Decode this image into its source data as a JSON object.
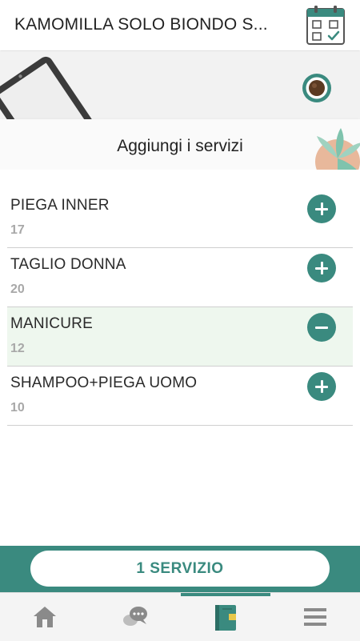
{
  "header": {
    "title": "KAMOMILLA SOLO BIONDO S...",
    "calendar_icon": "calendar-check-icon"
  },
  "hero": {
    "title": "Aggiungi i servizi",
    "illustrations": [
      "tablet-icon",
      "coffee-cup-icon",
      "plant-icon"
    ]
  },
  "services": [
    {
      "name": "PIEGA INNER",
      "duration": "17",
      "selected": false
    },
    {
      "name": "TAGLIO DONNA",
      "duration": "20",
      "selected": false
    },
    {
      "name": "MANICURE",
      "duration": "12",
      "selected": true
    },
    {
      "name": "SHAMPOO+PIEGA UOMO",
      "duration": "10",
      "selected": false
    }
  ],
  "cart": {
    "label": "1 SERVIZIO"
  },
  "bottom_nav": {
    "items": [
      {
        "icon": "home-icon",
        "active": false
      },
      {
        "icon": "chat-icon",
        "active": false
      },
      {
        "icon": "agenda-book-icon",
        "active": true
      },
      {
        "icon": "menu-icon",
        "active": false
      }
    ]
  },
  "colors": {
    "accent": "#3a8a7f",
    "selected_row": "#eef7ee",
    "duration_text": "#a8a8a8"
  }
}
